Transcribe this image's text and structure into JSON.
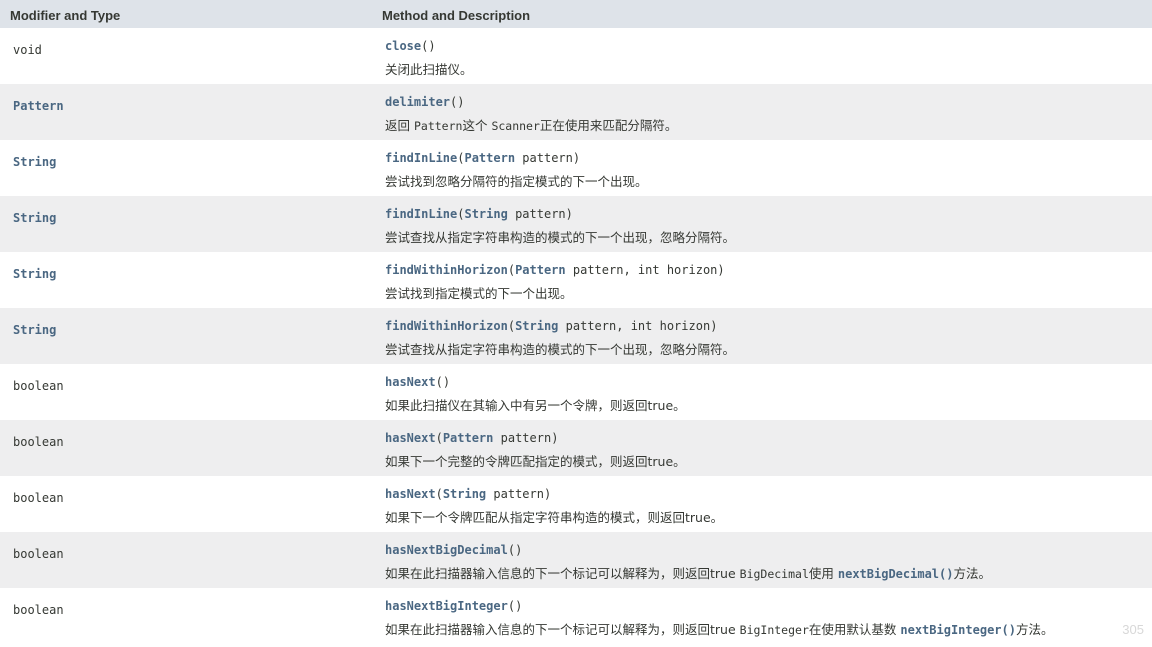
{
  "header": {
    "col1": "Modifier and Type",
    "col2": "Method and Description"
  },
  "rows": [
    {
      "type": "void",
      "type_link": false,
      "method": "close",
      "params": [],
      "desc": [
        {
          "t": "关闭此扫描仪。"
        }
      ]
    },
    {
      "type": "Pattern",
      "type_link": true,
      "method": "delimiter",
      "params": [],
      "desc": [
        {
          "t": "返回 "
        },
        {
          "code": "Pattern"
        },
        {
          "t": "这个 "
        },
        {
          "code": "Scanner"
        },
        {
          "t": "正在使用来匹配分隔符。"
        }
      ]
    },
    {
      "type": "String",
      "type_link": true,
      "method": "findInLine",
      "params": [
        {
          "ptype": "Pattern",
          "pname": "pattern"
        }
      ],
      "desc": [
        {
          "t": "尝试找到忽略分隔符的指定模式的下一个出现。"
        }
      ]
    },
    {
      "type": "String",
      "type_link": true,
      "method": "findInLine",
      "params": [
        {
          "ptype": "String",
          "pname": "pattern"
        }
      ],
      "desc": [
        {
          "t": "尝试查找从指定字符串构造的模式的下一个出现，忽略分隔符。"
        }
      ]
    },
    {
      "type": "String",
      "type_link": true,
      "method": "findWithinHorizon",
      "params": [
        {
          "ptype": "Pattern",
          "pname": "pattern"
        },
        {
          "ptype": "int",
          "pname": "horizon",
          "plain": true
        }
      ],
      "desc": [
        {
          "t": "尝试找到指定模式的下一个出现。"
        }
      ]
    },
    {
      "type": "String",
      "type_link": true,
      "method": "findWithinHorizon",
      "params": [
        {
          "ptype": "String",
          "pname": "pattern"
        },
        {
          "ptype": "int",
          "pname": "horizon",
          "plain": true
        }
      ],
      "desc": [
        {
          "t": "尝试查找从指定字符串构造的模式的下一个出现，忽略分隔符。"
        }
      ]
    },
    {
      "type": "boolean",
      "type_link": false,
      "method": "hasNext",
      "params": [],
      "desc": [
        {
          "t": "如果此扫描仪在其输入中有另一个令牌，则返回true。"
        }
      ]
    },
    {
      "type": "boolean",
      "type_link": false,
      "method": "hasNext",
      "params": [
        {
          "ptype": "Pattern",
          "pname": "pattern"
        }
      ],
      "desc": [
        {
          "t": "如果下一个完整的令牌匹配指定的模式，则返回true。"
        }
      ]
    },
    {
      "type": "boolean",
      "type_link": false,
      "method": "hasNext",
      "params": [
        {
          "ptype": "String",
          "pname": "pattern"
        }
      ],
      "desc": [
        {
          "t": "如果下一个令牌匹配从指定字符串构造的模式，则返回true。"
        }
      ]
    },
    {
      "type": "boolean",
      "type_link": false,
      "method": "hasNextBigDecimal",
      "params": [],
      "desc": [
        {
          "t": "如果在此扫描器输入信息的下一个标记可以解释为，则返回true "
        },
        {
          "code": "BigDecimal"
        },
        {
          "t": "使用 "
        },
        {
          "link": "nextBigDecimal()"
        },
        {
          "t": "方法。"
        }
      ]
    },
    {
      "type": "boolean",
      "type_link": false,
      "method": "hasNextBigInteger",
      "params": [],
      "desc": [
        {
          "t": "如果在此扫描器输入信息的下一个标记可以解释为，则返回true "
        },
        {
          "code": "BigInteger"
        },
        {
          "t": "在使用默认基数 "
        },
        {
          "link": "nextBigInteger()"
        },
        {
          "t": "方法。"
        }
      ]
    }
  ],
  "watermark": "305"
}
